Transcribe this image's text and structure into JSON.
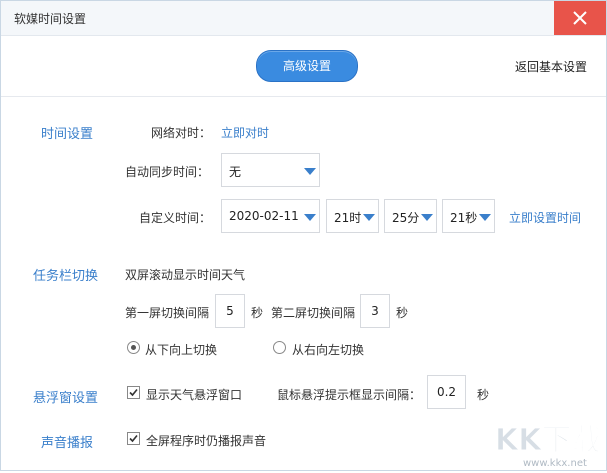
{
  "window": {
    "title": "软媒时间设置"
  },
  "toolbar": {
    "advanced_label": "高级设置",
    "back_label": "返回基本设置"
  },
  "time": {
    "section": "时间设置",
    "network_label": "网络对时：",
    "network_link": "立即对时",
    "auto_sync_label": "自动同步时间：",
    "auto_sync_value": "无",
    "custom_label": "自定义时间：",
    "date_value": "2020-02-11",
    "hour_value": "21时",
    "minute_value": "25分",
    "second_value": "21秒",
    "set_now_link": "立即设置时间"
  },
  "taskbar": {
    "section": "任务栏切换",
    "dual_label": "双屏滚动显示时间天气",
    "first_label": "第一屏切换间隔",
    "first_value": "5",
    "first_unit": "秒",
    "second_label": "第二屏切换间隔",
    "second_value": "3",
    "second_unit": "秒",
    "radio_bottom_up": "从下向上切换",
    "radio_right_left": "从右向左切换",
    "radio_selected": "从下向上切换"
  },
  "float": {
    "section": "悬浮窗设置",
    "show_weather_label": "显示天气悬浮窗口",
    "show_weather_checked": true,
    "tooltip_label": "鼠标悬浮提示框显示间隔：",
    "tooltip_value": "0.2",
    "tooltip_unit": "秒"
  },
  "sound": {
    "section": "声音播报",
    "fullscreen_label": "全屏程序时仍播报声音",
    "fullscreen_checked": true
  },
  "watermark": {
    "text": "KK下载",
    "url": "www.kkx.net"
  }
}
